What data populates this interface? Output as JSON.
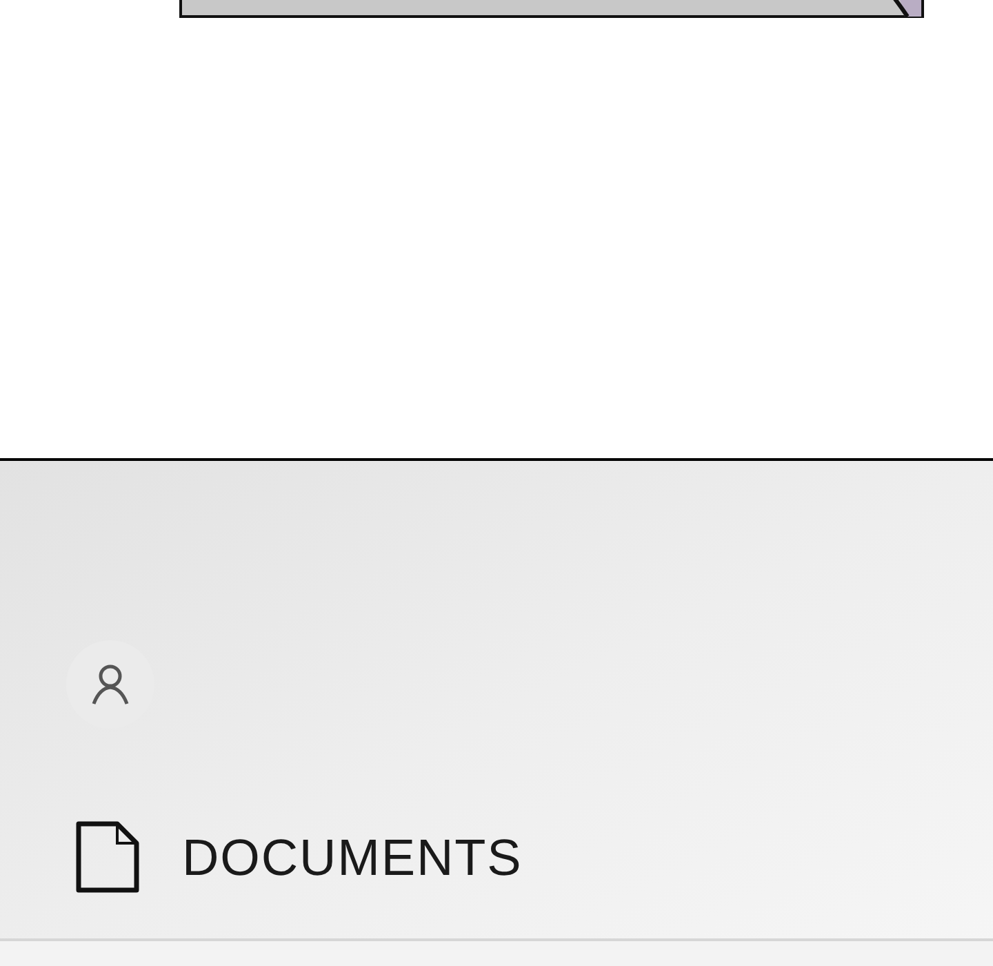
{
  "nav_item": {
    "label": "DOCUMENTS"
  }
}
